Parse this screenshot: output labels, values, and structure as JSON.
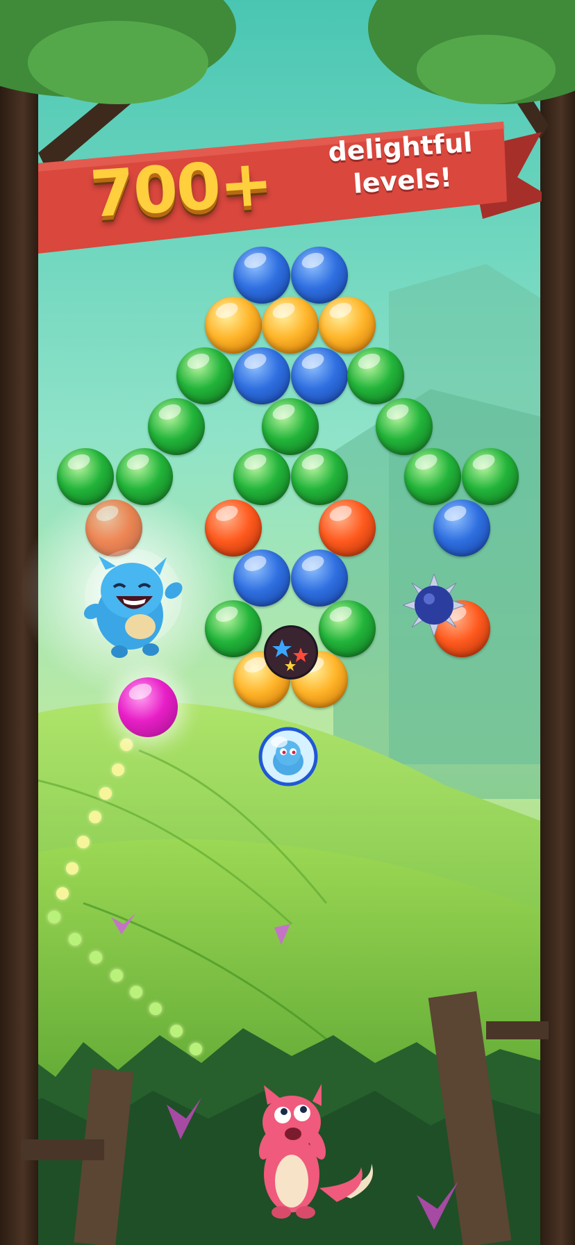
{
  "banner": {
    "big_text": "700+",
    "small_text_line1": "delightful",
    "small_text_line2": "levels!"
  },
  "colors": {
    "blue": "#2f6fe0",
    "yellow": "#ffb52a",
    "green": "#22b43a",
    "orange": "#ff5a1e",
    "magenta": "#e81fc7",
    "banner_red": "#d9473d",
    "sky": "#7fdcc7",
    "trunk": "#3d2a1c"
  },
  "icons": [
    "blue-bubble",
    "yellow-bubble",
    "green-bubble",
    "orange-bubble",
    "spiky-mine-icon",
    "star-bomb-icon",
    "trapped-pet-icon",
    "blue-pet-character",
    "pink-cat-character",
    "magenta-shot-bubble"
  ]
}
